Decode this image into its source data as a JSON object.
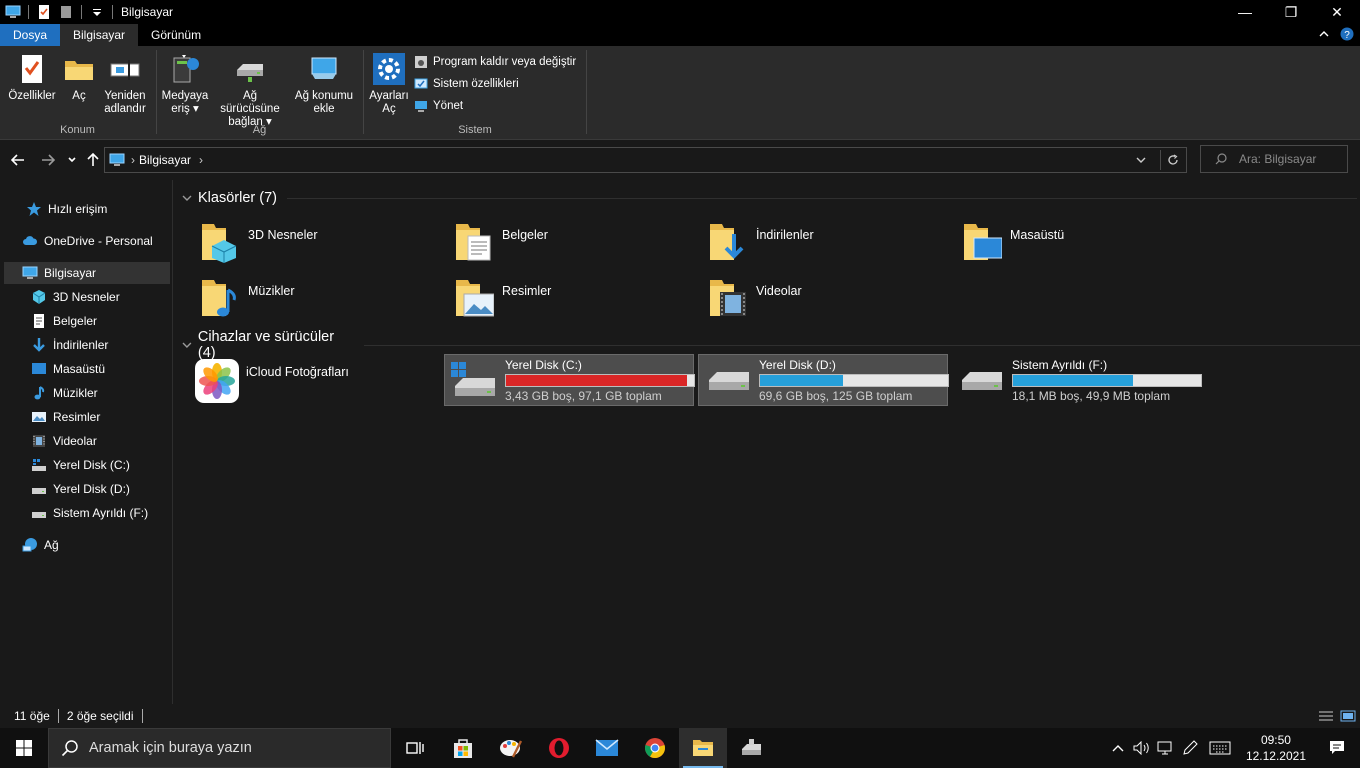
{
  "window": {
    "title": "Bilgisayar",
    "minimize": "—",
    "maximize": "❐",
    "close": "✕"
  },
  "ribbon_tabs": {
    "file": "Dosya",
    "computer": "Bilgisayar",
    "view": "Görünüm"
  },
  "ribbon": {
    "konum": {
      "label": "Konum",
      "properties": "Özellikler",
      "open": "Aç",
      "rename_1": "Yeniden",
      "rename_2": "adlandır"
    },
    "ag": {
      "label": "Ağ",
      "media_1": "Medyaya",
      "media_2": "eriş",
      "map_1": "Ağ sürücüsüne",
      "map_2": "bağlan",
      "add_1": "Ağ konumu",
      "add_2": "ekle"
    },
    "sistem": {
      "label": "Sistem",
      "settings_1": "Ayarları",
      "settings_2": "Aç",
      "uninstall": "Program kaldır veya değiştir",
      "system_props": "Sistem özellikleri",
      "manage": "Yönet"
    }
  },
  "address": {
    "crumb": "Bilgisayar",
    "search_placeholder": "Ara: Bilgisayar"
  },
  "sidebar": {
    "quick_access": "Hızlı erişim",
    "onedrive": "OneDrive - Personal",
    "computer": "Bilgisayar",
    "items": [
      "3D Nesneler",
      "Belgeler",
      "İndirilenler",
      "Masaüstü",
      "Müzikler",
      "Resimler",
      "Videolar",
      "Yerel Disk (C:)",
      "Yerel Disk (D:)",
      "Sistem Ayrıldı (F:)"
    ],
    "network": "Ağ"
  },
  "main": {
    "folders_header": "Klasörler (7)",
    "folders": [
      "3D Nesneler",
      "Belgeler",
      "İndirilenler",
      "Masaüstü",
      "Müzikler",
      "Resimler",
      "Videolar"
    ],
    "devices_header": "Cihazlar ve sürücüler (4)",
    "icloud": "iCloud Fotoğrafları",
    "drives": [
      {
        "name": "Yerel Disk (C:)",
        "info": "3,43 GB boş, 97,1 GB toplam",
        "used_fraction": 0.965,
        "color": "#da2626"
      },
      {
        "name": "Yerel Disk (D:)",
        "info": "69,6 GB boş, 125 GB toplam",
        "used_fraction": 0.443,
        "color": "#26a0da"
      },
      {
        "name": "Sistem Ayrıldı (F:)",
        "info": "18,1 MB boş, 49,9 MB toplam",
        "used_fraction": 0.637,
        "color": "#26a0da"
      }
    ]
  },
  "status": {
    "count": "11 öğe",
    "selected": "2 öğe seçildi"
  },
  "taskbar": {
    "search_placeholder": "Aramak için buraya yazın",
    "time": "09:50",
    "date": "12.12.2021"
  }
}
